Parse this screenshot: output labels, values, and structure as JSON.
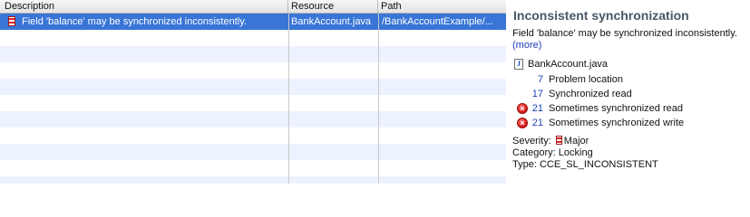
{
  "table": {
    "headers": {
      "description": "Description",
      "resource": "Resource",
      "path": "Path"
    },
    "rows": [
      {
        "description": "Field 'balance' may be synchronized inconsistently.",
        "resource": "BankAccount.java",
        "path": "/BankAccountExample/...",
        "severity_icon": "major-severity-icon",
        "selected": true
      }
    ],
    "selection_color": "#3875d7",
    "stripe_color": "#edf3fe"
  },
  "details": {
    "title": "Inconsistent synchronization",
    "message": "Field 'balance' may be synchronized inconsistently.",
    "more_link": "(more)",
    "file": {
      "icon": "java-file-icon",
      "icon_glyph": "J",
      "name": "BankAccount.java"
    },
    "locations": [
      {
        "line": "7",
        "label": "Problem location",
        "icon": null
      },
      {
        "line": "17",
        "label": "Synchronized read",
        "icon": null
      },
      {
        "line": "21",
        "label": "Sometimes synchronized read",
        "icon": "error-icon"
      },
      {
        "line": "21",
        "label": "Sometimes synchronized write",
        "icon": "error-icon"
      }
    ],
    "severity_label": "Severity:",
    "severity_value": "Major",
    "category_label": "Category:",
    "category_value": "Locking",
    "type_label": "Type:",
    "type_value": "CCE_SL_INCONSISTENT",
    "title_color": "#4a5766",
    "link_color": "#1a3fb8"
  }
}
